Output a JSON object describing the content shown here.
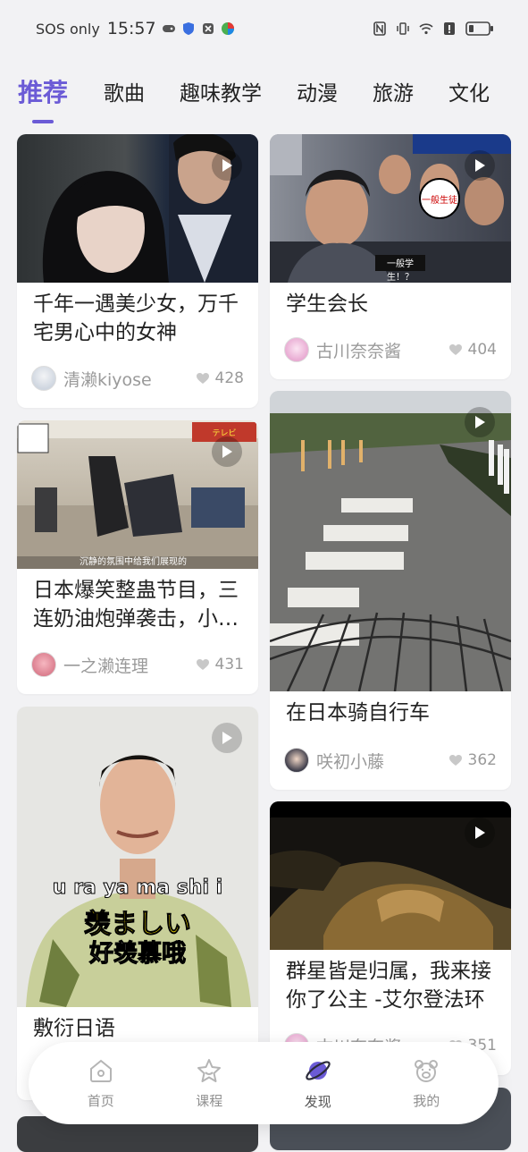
{
  "status_bar": {
    "carrier": "SOS only",
    "time": "15:57"
  },
  "tabs": [
    {
      "label": "推荐",
      "active": true
    },
    {
      "label": "歌曲",
      "active": false
    },
    {
      "label": "趣味教学",
      "active": false
    },
    {
      "label": "动漫",
      "active": false
    },
    {
      "label": "旅游",
      "active": false
    },
    {
      "label": "文化",
      "active": false
    }
  ],
  "feed": {
    "left": [
      {
        "title": "千年一遇美少女，万千宅男心中的女神",
        "author": "清濑kiyose",
        "likes": "428"
      },
      {
        "title": "日本爆笑整蛊节目，三连奶油炮弹袭击，小哥…",
        "author": "一之濑连理",
        "likes": "431",
        "caption": "沉静的氛围中给我们展现的"
      },
      {
        "title": "敷衍日语",
        "caption_top": "u ra ya ma shi i",
        "caption_mid": "羡ましい",
        "caption_bottom": "好羡慕哦"
      }
    ],
    "right": [
      {
        "title": "学生会长",
        "author": "古川奈奈酱",
        "likes": "404",
        "caption": "一般学生！？"
      },
      {
        "title": "在日本骑自行车",
        "author": "咲初小藤",
        "likes": "362"
      },
      {
        "title": "群星皆是归属，我来接你了公主 -艾尔登法环",
        "author": "古川奈奈酱",
        "likes": "351"
      }
    ]
  },
  "bottom_nav": [
    {
      "label": "首页",
      "icon": "home-icon"
    },
    {
      "label": "课程",
      "icon": "star-icon"
    },
    {
      "label": "发现",
      "icon": "planet-icon",
      "active": true
    },
    {
      "label": "我的",
      "icon": "bear-icon"
    }
  ],
  "colors": {
    "accent": "#6b5bd6",
    "background": "#f2f2f4"
  }
}
